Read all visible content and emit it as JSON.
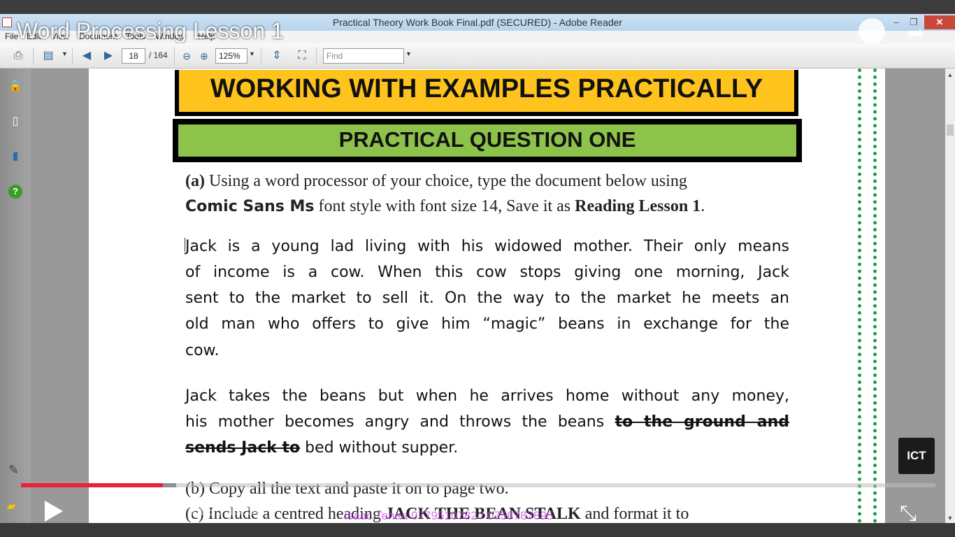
{
  "window": {
    "title": "Practical Theory Work Book Final.pdf (SECURED) - Adobe Reader",
    "min": "–",
    "max": "❐",
    "close": "✕"
  },
  "menu": [
    "File",
    "Edit",
    "View",
    "Document",
    "Tools",
    "Window",
    "Help"
  ],
  "video": {
    "title": "Word Processing Lesson 1",
    "time": "3:08 / 19:56",
    "scroll_hint": "Scroll for details",
    "watermark": "Isaac Tenaa 0779510782 / 0758787895",
    "progress": 0.155,
    "logo_text": "ICT"
  },
  "toolbar": {
    "page_current": "18",
    "page_total": "/ 164",
    "zoom": "125%",
    "find_placeholder": "Find"
  },
  "document": {
    "heading1": "WORKING WITH EXAMPLES PRACTICALLY",
    "heading2": "PRACTICAL QUESTION ONE",
    "q_a_label": "(a)",
    "q_a_line1": " Using a word processor of your choice, type the document below using",
    "q_a_font_name": "Comic Sans Ms",
    "q_a_line2_mid": " font style with font size 14, Save it as ",
    "q_a_save_name": "Reading Lesson 1",
    "q_a_line2_end": ".",
    "para1": [
      "Jack is a young lad living with his widowed mother. Their only means",
      "of income is a cow. When this cow stops giving one morning, Jack",
      "sent to the market to sell it. On the way to the market he meets an",
      "old man who offers to give him “magic” beans in exchange for the",
      "cow."
    ],
    "para2_line1": "Jack takes the beans but when he arrives home without any money,",
    "para2_line2_a": "his mother becomes angry and throws the beans ",
    "para2_line2_strike": "to the ground and",
    "para2_line3_strike": "sends Jack to",
    "para2_line3_b": " bed without supper.",
    "q_b": "(b) Copy all the text and paste it on to page two.",
    "q_c_a": "(c) Include a centred heading ",
    "q_c_bold": "JACK THE BEAN STALK",
    "q_c_b": " and format it to"
  }
}
